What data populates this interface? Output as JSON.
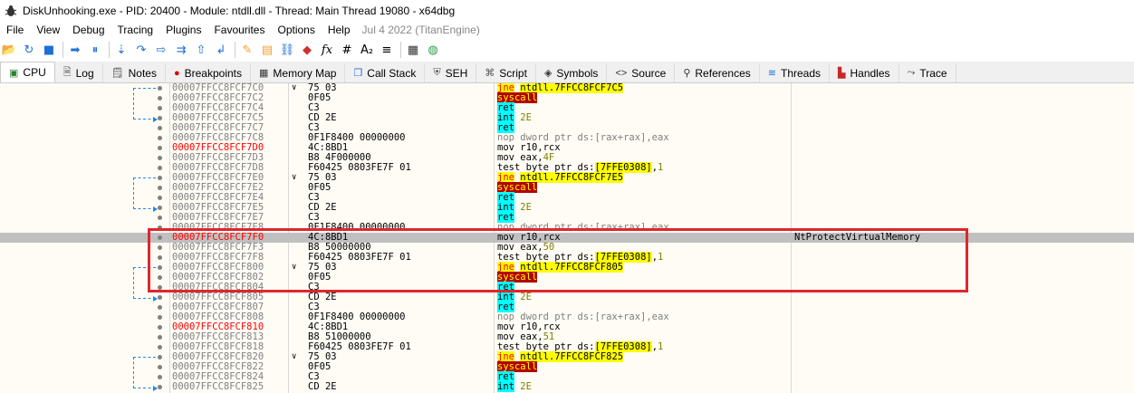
{
  "window": {
    "title": "DiskUnhooking.exe - PID: 20400 - Module: ntdll.dll - Thread: Main Thread 19080 - x64dbg",
    "icon": "bug-icon"
  },
  "menu": {
    "items": [
      "File",
      "View",
      "Debug",
      "Tracing",
      "Plugins",
      "Favourites",
      "Options",
      "Help"
    ],
    "build_date": "Jul 4 2022 (TitanEngine)"
  },
  "toolbar": {
    "buttons": [
      {
        "name": "open-icon",
        "glyph": "📂"
      },
      {
        "name": "restart-icon",
        "glyph": "↻"
      },
      {
        "name": "stop-icon",
        "glyph": "■"
      },
      {
        "name": "run-icon",
        "glyph": "➡"
      },
      {
        "name": "pause-icon",
        "glyph": "⏸"
      },
      {
        "name": "step-into-icon",
        "glyph": "⇣"
      },
      {
        "name": "step-over-icon",
        "glyph": "↷"
      },
      {
        "name": "trace-into-icon",
        "glyph": "⇨"
      },
      {
        "name": "trace-over-icon",
        "glyph": "⇉"
      },
      {
        "name": "run-to-user-icon",
        "glyph": "⇧"
      },
      {
        "name": "execute-till-return-icon",
        "glyph": "↲"
      },
      {
        "name": "pen-icon",
        "glyph": "✎"
      },
      {
        "name": "note-icon",
        "glyph": "▤"
      },
      {
        "name": "link-icon",
        "glyph": "⛓"
      },
      {
        "name": "tag-icon",
        "glyph": "◆"
      },
      {
        "name": "function-icon",
        "glyph": "fx"
      },
      {
        "name": "hash-icon",
        "glyph": "#"
      },
      {
        "name": "font-icon",
        "glyph": "A₂"
      },
      {
        "name": "list-icon",
        "glyph": "≡"
      },
      {
        "name": "calculator-icon",
        "glyph": "▦"
      },
      {
        "name": "globe-icon",
        "glyph": "◍"
      }
    ],
    "colors": {
      "blue": "#1e6fd9",
      "orange": "#f0a030",
      "red": "#d03030",
      "green": "#2e9e4a"
    }
  },
  "tabs": [
    {
      "label": "CPU",
      "icon": "cpu-icon",
      "glyph": "▣",
      "active": true
    },
    {
      "label": "Log",
      "icon": "log-icon",
      "glyph": "🗎"
    },
    {
      "label": "Notes",
      "icon": "notes-icon",
      "glyph": "🗒"
    },
    {
      "label": "Breakpoints",
      "icon": "breakpoint-icon",
      "glyph": "●"
    },
    {
      "label": "Memory Map",
      "icon": "memory-map-icon",
      "glyph": "▦"
    },
    {
      "label": "Call Stack",
      "icon": "call-stack-icon",
      "glyph": "❐"
    },
    {
      "label": "SEH",
      "icon": "seh-icon",
      "glyph": "⛨"
    },
    {
      "label": "Script",
      "icon": "script-icon",
      "glyph": "⌘"
    },
    {
      "label": "Symbols",
      "icon": "symbols-icon",
      "glyph": "◈"
    },
    {
      "label": "Source",
      "icon": "source-icon",
      "glyph": "<>"
    },
    {
      "label": "References",
      "icon": "references-icon",
      "glyph": "⚲"
    },
    {
      "label": "Threads",
      "icon": "threads-icon",
      "glyph": "≋"
    },
    {
      "label": "Handles",
      "icon": "handles-icon",
      "glyph": "▙"
    },
    {
      "label": "Trace",
      "icon": "trace-icon",
      "glyph": "⤳"
    }
  ],
  "disasm": {
    "rows": [
      {
        "addr": "00007FFCC8FCF7C0",
        "arrow": "∨",
        "bytes": "75 03",
        "type": "jne",
        "mn": "jne",
        "op": "ntdll.7FFCC8FCF7C5"
      },
      {
        "addr": "00007FFCC8FCF7C2",
        "bytes": "0F05",
        "type": "syscall",
        "mn": "syscall"
      },
      {
        "addr": "00007FFCC8FCF7C4",
        "bytes": "C3",
        "type": "ret",
        "mn": "ret"
      },
      {
        "addr": "00007FFCC8FCF7C5",
        "bytes": "CD 2E",
        "type": "int",
        "mn": "int",
        "op": "2E"
      },
      {
        "addr": "00007FFCC8FCF7C7",
        "bytes": "C3",
        "type": "ret",
        "mn": "ret"
      },
      {
        "addr": "00007FFCC8FCF7C8",
        "bytes": "0F1F8400 00000000",
        "type": "nop",
        "text": "nop dword ptr ds:[rax+rax],eax"
      },
      {
        "addr": "00007FFCC8FCF7D0",
        "red": true,
        "bytes": "4C:8BD1",
        "type": "mov",
        "mn": "mov",
        "op": "r10,rcx"
      },
      {
        "addr": "00007FFCC8FCF7D3",
        "bytes": "B8 4F000000",
        "type": "movnum",
        "mn": "mov",
        "op": "eax,",
        "num": "4F"
      },
      {
        "addr": "00007FFCC8FCF7D8",
        "bytes": "F60425 0803FE7F 01",
        "type": "test",
        "mn": "test",
        "op": "byte ptr ",
        "seg": "ds:",
        "mem": "[7FFE0308]",
        "tail": ",",
        "num": "1"
      },
      {
        "addr": "00007FFCC8FCF7E0",
        "arrow": "∨",
        "bytes": "75 03",
        "type": "jne",
        "mn": "jne",
        "op": "ntdll.7FFCC8FCF7E5"
      },
      {
        "addr": "00007FFCC8FCF7E2",
        "bytes": "0F05",
        "type": "syscall",
        "mn": "syscall"
      },
      {
        "addr": "00007FFCC8FCF7E4",
        "bytes": "C3",
        "type": "ret",
        "mn": "ret"
      },
      {
        "addr": "00007FFCC8FCF7E5",
        "bytes": "CD 2E",
        "type": "int",
        "mn": "int",
        "op": "2E"
      },
      {
        "addr": "00007FFCC8FCF7E7",
        "bytes": "C3",
        "type": "ret",
        "mn": "ret"
      },
      {
        "addr": "00007FFCC8FCF7E8",
        "bytes": "0F1F8400 00000000",
        "type": "nop",
        "text": "nop dword ptr ds:[rax+rax],eax",
        "partial": true
      },
      {
        "addr": "00007FFCC8FCF7F0",
        "red": true,
        "hl": true,
        "bytes": "4C:8BD1",
        "type": "mov",
        "mn": "mov",
        "op": "r10,rcx",
        "comment": "NtProtectVirtualMemory"
      },
      {
        "addr": "00007FFCC8FCF7F3",
        "bytes": "B8 50000000",
        "type": "movnum",
        "mn": "mov",
        "op": "eax,",
        "num": "50"
      },
      {
        "addr": "00007FFCC8FCF7F8",
        "bytes": "F60425 0803FE7F 01",
        "type": "test",
        "mn": "test",
        "op": "byte ptr ",
        "seg": "ds:",
        "mem": "[7FFE0308]",
        "tail": ",",
        "num": "1"
      },
      {
        "addr": "00007FFCC8FCF800",
        "arrow": "∨",
        "bytes": "75 03",
        "type": "jne",
        "mn": "jne",
        "op": "ntdll.7FFCC8FCF805"
      },
      {
        "addr": "00007FFCC8FCF802",
        "bytes": "0F05",
        "type": "syscall",
        "mn": "syscall"
      },
      {
        "addr": "00007FFCC8FCF804",
        "bytes": "C3",
        "type": "ret",
        "mn": "ret"
      },
      {
        "addr": "00007FFCC8FCF805",
        "bytes": "CD 2E",
        "type": "int",
        "mn": "int",
        "op": "2E"
      },
      {
        "addr": "00007FFCC8FCF807",
        "bytes": "C3",
        "type": "ret",
        "mn": "ret"
      },
      {
        "addr": "00007FFCC8FCF808",
        "bytes": "0F1F8400 00000000",
        "type": "nop",
        "text": "nop dword ptr ds:[rax+rax],eax"
      },
      {
        "addr": "00007FFCC8FCF810",
        "red": true,
        "bytes": "4C:8BD1",
        "type": "mov",
        "mn": "mov",
        "op": "r10,rcx"
      },
      {
        "addr": "00007FFCC8FCF813",
        "bytes": "B8 51000000",
        "type": "movnum",
        "mn": "mov",
        "op": "eax,",
        "num": "51"
      },
      {
        "addr": "00007FFCC8FCF818",
        "bytes": "F60425 0803FE7F 01",
        "type": "test",
        "mn": "test",
        "op": "byte ptr ",
        "seg": "ds:",
        "mem": "[7FFE0308]",
        "tail": ",",
        "num": "1"
      },
      {
        "addr": "00007FFCC8FCF820",
        "arrow": "∨",
        "bytes": "75 03",
        "type": "jne",
        "mn": "jne",
        "op": "ntdll.7FFCC8FCF825"
      },
      {
        "addr": "00007FFCC8FCF822",
        "bytes": "0F05",
        "type": "syscall",
        "mn": "syscall"
      },
      {
        "addr": "00007FFCC8FCF824",
        "bytes": "C3",
        "type": "ret",
        "mn": "ret"
      },
      {
        "addr": "00007FFCC8FCF825",
        "bytes": "CD 2E",
        "type": "int",
        "mn": "int",
        "op": "2E"
      }
    ]
  }
}
